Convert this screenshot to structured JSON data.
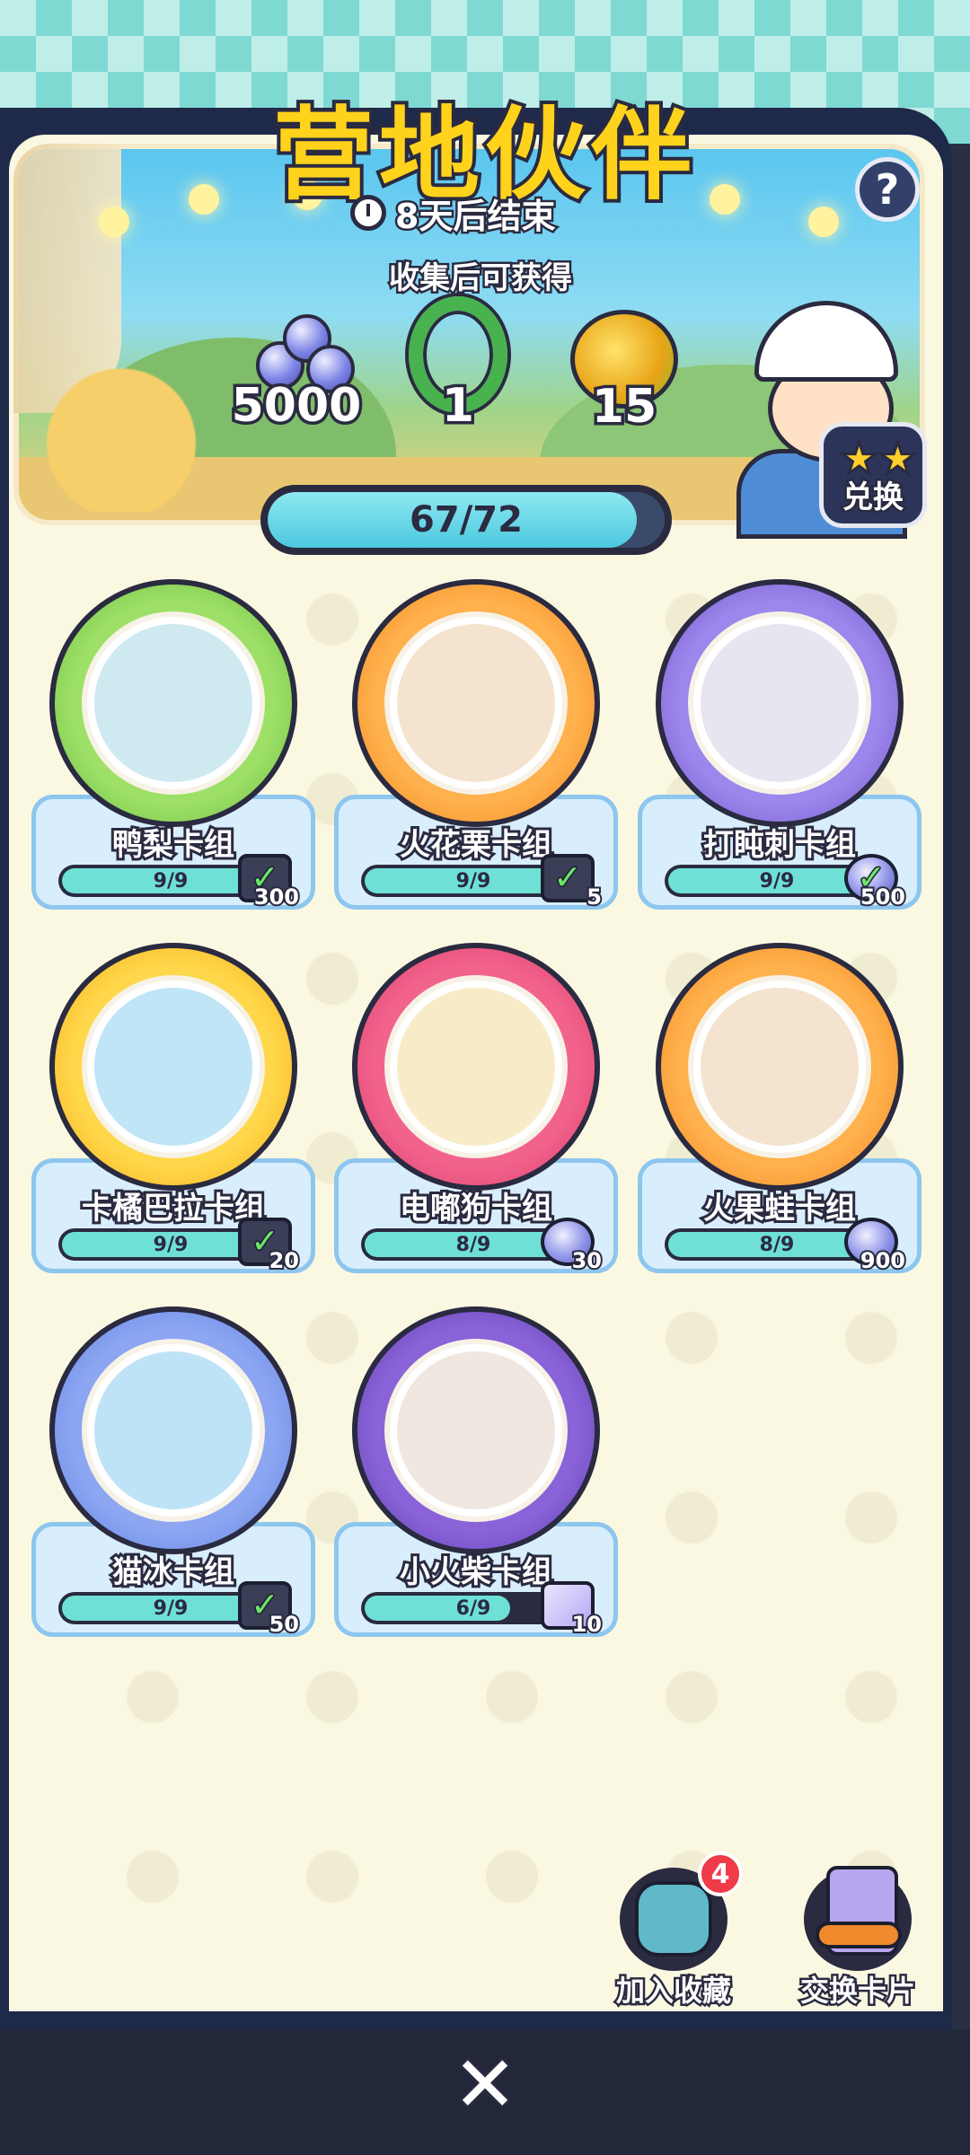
{
  "event": {
    "title": "营地伙伴",
    "timer_text": "8天后结束",
    "reward_caption": "收集后可获得",
    "help_label": "?",
    "exchange_label": "兑换",
    "progress_text": "67/72",
    "progress_fraction": 0.93
  },
  "rewards": [
    {
      "icon": "gems-icon",
      "value": "5000"
    },
    {
      "icon": "wreath-frame-icon",
      "value": "1"
    },
    {
      "icon": "golden-fruit-icon",
      "value": "15"
    }
  ],
  "cards": [
    {
      "name": "鸭梨卡组",
      "progress": "9/9",
      "fraction": 1.0,
      "color": "green",
      "reward_icon": "box-icon",
      "reward_amount": "300",
      "completed": true
    },
    {
      "name": "火花栗卡组",
      "progress": "9/9",
      "fraction": 1.0,
      "color": "orange",
      "reward_icon": "dice-icon",
      "reward_amount": "5",
      "completed": true
    },
    {
      "name": "打盹刺卡组",
      "progress": "9/9",
      "fraction": 1.0,
      "color": "purple",
      "reward_icon": "gems-icon",
      "reward_amount": "500",
      "completed": true
    },
    {
      "name": "卡橘巴拉卡组",
      "progress": "9/9",
      "fraction": 1.0,
      "color": "yellow",
      "reward_icon": "box-icon",
      "reward_amount": "20",
      "completed": true
    },
    {
      "name": "电嘟狗卡组",
      "progress": "8/9",
      "fraction": 0.89,
      "color": "pink",
      "reward_icon": "gems-icon",
      "reward_amount": "30",
      "completed": false
    },
    {
      "name": "火果蛙卡组",
      "progress": "8/9",
      "fraction": 0.89,
      "color": "orange",
      "reward_icon": "gems-icon",
      "reward_amount": "900",
      "completed": false
    },
    {
      "name": "猫冰卡组",
      "progress": "9/9",
      "fraction": 1.0,
      "color": "blue",
      "reward_icon": "box-icon",
      "reward_amount": "50",
      "completed": true
    },
    {
      "name": "小火柴卡组",
      "progress": "6/9",
      "fraction": 0.67,
      "color": "deeppurple",
      "reward_icon": "card-pack-icon",
      "reward_amount": "10",
      "completed": false
    }
  ],
  "actions": {
    "collection_label": "加入收藏",
    "collection_badge": "4",
    "trade_label": "交换卡片"
  },
  "colors": {
    "title_yellow": "#ffd21c",
    "progress_teal": "#6fe0d6",
    "panel_navy": "#1f2a4a",
    "badge_red": "#ef3b4a"
  }
}
